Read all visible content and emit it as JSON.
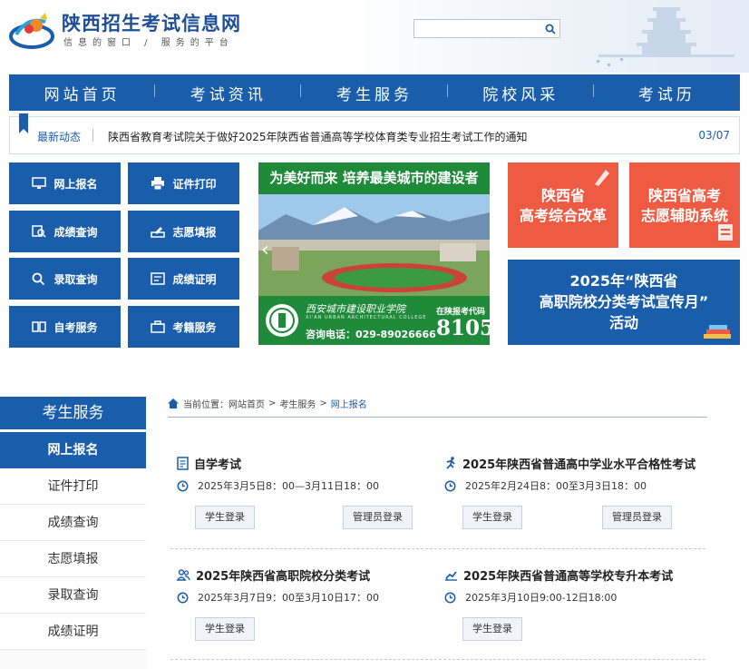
{
  "header": {
    "site_title": "陕西招生考试信息网",
    "slogan": "信息的窗口 / 服务的平台",
    "search_placeholder": ""
  },
  "nav": {
    "items": [
      "网站首页",
      "考试资讯",
      "考生服务",
      "院校风采",
      "考试历"
    ]
  },
  "ticker": {
    "label": "最新动态",
    "text": "陕西省教育考试院关于做好2025年陕西省普通高等学校体育类专业招生考试工作的通知",
    "date": "03/07"
  },
  "quick_links": [
    "网上报名",
    "证件打印",
    "成绩查询",
    "志愿填报",
    "录取查询",
    "成绩证明",
    "自考服务",
    "考籍服务"
  ],
  "banner": {
    "headline": "为美好而来 培养最美城市的建设者",
    "college": "西安城市建设职业学院",
    "college_en": "XI'AN URBAN ARCHITECTURAL COLLEGE",
    "phone": "咨询电话：029-89026666",
    "code_label": "在陕报考代码",
    "code": "8105"
  },
  "promos": {
    "reform": [
      "陕西省",
      "高考综合改革"
    ],
    "assist": [
      "陕西省高考",
      "志愿辅助系统"
    ],
    "month": [
      "2025年“陕西省",
      "高职院校分类考试宣传月”",
      "活动"
    ]
  },
  "sidebar": {
    "heading": "考生服务",
    "items": [
      "网上报名",
      "证件打印",
      "成绩查询",
      "志愿填报",
      "录取查询",
      "成绩证明"
    ],
    "active_index": 0
  },
  "breadcrumb": {
    "label": "当前位置：",
    "items": [
      "网站首页",
      "考生服务",
      "网上报名"
    ],
    "sep": ">"
  },
  "exams": [
    {
      "title": "自学考试",
      "time": "2025年3月5日8：00—3月11日18：00",
      "buttons": [
        "学生登录",
        "管理员登录"
      ],
      "icon": "document-icon"
    },
    {
      "title": "2025年陕西省普通高中学业水平合格性考试",
      "time": "2025年2月24日8：00至3月3日18：00",
      "buttons": [
        "学生登录",
        "管理员登录"
      ],
      "icon": "running-icon"
    },
    {
      "title": "2025年陕西省高职院校分类考试",
      "time": "2025年3月7日9：00至3月10日17：00",
      "buttons": [
        "学生登录"
      ],
      "icon": "people-icon"
    },
    {
      "title": "2025年陕西省普通高等学校专升本考试",
      "time": "2025年3月10日9:00-12日18:00",
      "buttons": [
        "学生登录"
      ],
      "icon": "chart-icon"
    }
  ],
  "colors": {
    "primary": "#1a5dab",
    "promo_red": "#ef5a43",
    "banner_green": "#1f8a3a"
  }
}
